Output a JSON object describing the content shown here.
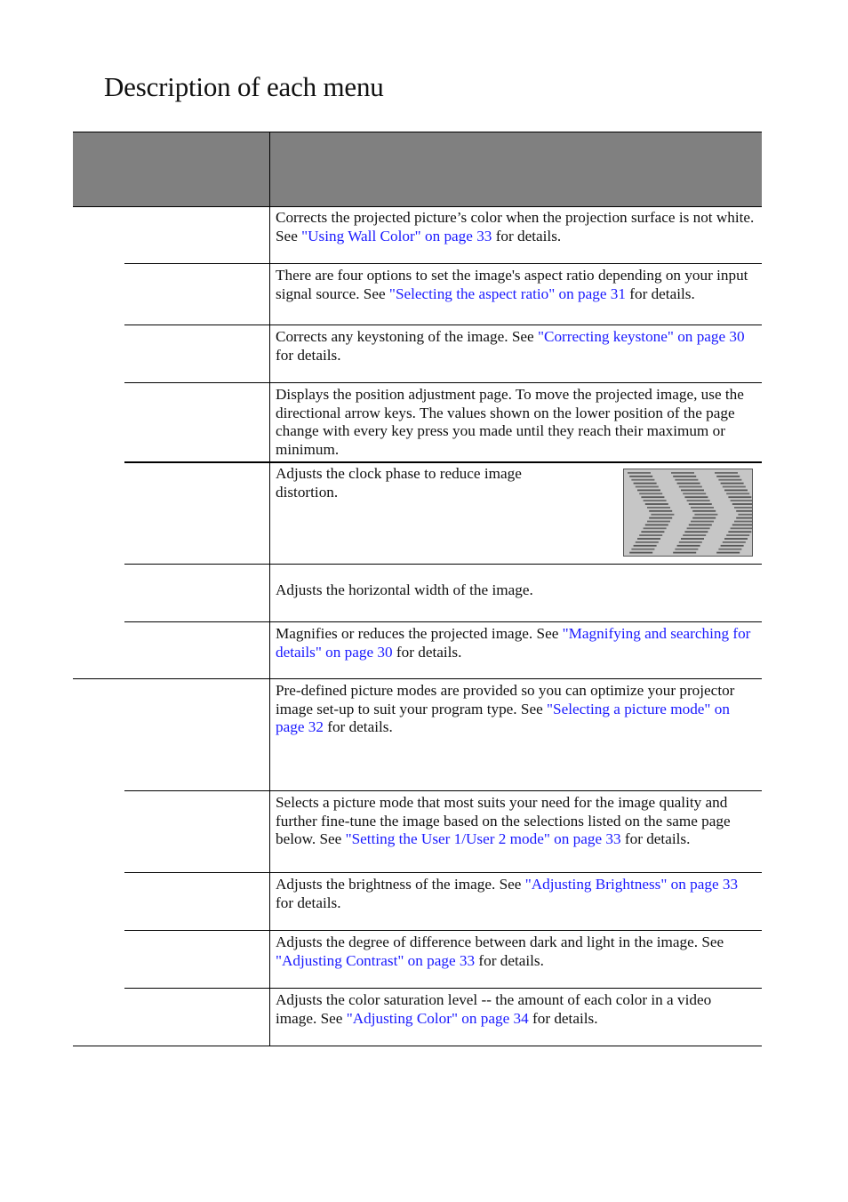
{
  "page": {
    "title": "Description of each menu"
  },
  "table": {
    "header": {
      "col1": "",
      "col2": ""
    },
    "rows": [
      {
        "name": "",
        "pre": "Corrects the projected picture’s color when the projection surface is not white. See ",
        "link": "\"Using Wall Color\" on page 33",
        "post": " for details."
      },
      {
        "name": "",
        "pre": "There are four options to set the image's aspect ratio depending on your input signal source. See ",
        "link": "\"Selecting the aspect ratio\" on page 31",
        "post": " for details."
      },
      {
        "name": "",
        "pre": "Corrects any keystoning of the image. See ",
        "link": "\"Correcting keystone\" on page 30",
        "post": " for details."
      },
      {
        "name": "",
        "pre": "Displays the position adjustment page. To move the projected image, use the directional arrow keys. The values shown on the lower position of the page change with every key press you made until they reach their maximum or minimum.",
        "link": "",
        "post": ""
      },
      {
        "name": "",
        "pre": "Adjusts the clock phase to reduce image distortion.",
        "link": "",
        "post": "",
        "image": "phase-distortion-illustration"
      },
      {
        "name": "",
        "pre": "Adjusts the horizontal width of the image.",
        "link": "",
        "post": ""
      },
      {
        "name": "",
        "pre": "Magnifies or reduces the projected image. See ",
        "link": "\"Magnifying and searching for details\" on page 30",
        "post": " for details."
      },
      {
        "name": "",
        "pre": "Pre-defined picture modes are provided so you can optimize your projector image set-up to suit your program type. See ",
        "link": "\"Selecting a picture mode\" on page 32",
        "post": " for details."
      },
      {
        "name": "",
        "pre": "Selects a picture mode that most suits your need for the image quality and further fine-tune the image based on the selections listed on the same page below. See ",
        "link": "\"Setting the User 1/User 2 mode\" on page 33",
        "post": " for details."
      },
      {
        "name": "",
        "pre": "Adjusts the brightness of the image. See ",
        "link": "\"Adjusting Brightness\" on page 33",
        "post": " for details."
      },
      {
        "name": "",
        "pre": "Adjusts the degree of difference between dark and light in the image. See ",
        "link": "\"Adjusting Contrast\" on page 33",
        "post": " for details."
      },
      {
        "name": "",
        "pre": "Adjusts the color saturation level -- the amount of each color in a video image. See ",
        "link": "\"Adjusting Color\" on page 34",
        "post": " for details."
      }
    ]
  },
  "colors": {
    "header_bg": "#808080",
    "link": "#1a1aff"
  }
}
